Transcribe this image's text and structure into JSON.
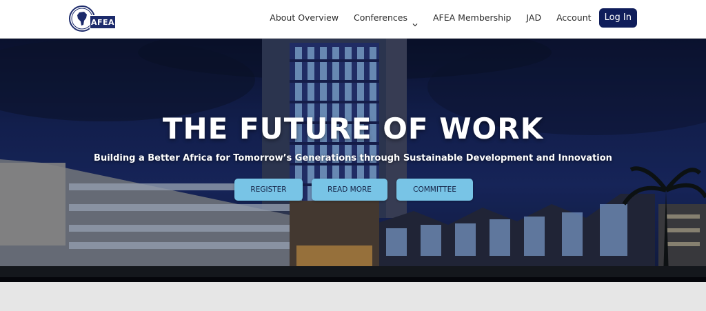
{
  "header": {
    "logo_text": "AFEA",
    "nav": [
      {
        "label": "About Overview",
        "icon": null
      },
      {
        "label": "Conferences",
        "icon": "chevron-down-icon"
      },
      {
        "label": "AFEA Membership",
        "icon": null
      },
      {
        "label": "JAD",
        "icon": null
      },
      {
        "label": "Account",
        "icon": null
      }
    ],
    "login_label": "Log In"
  },
  "hero": {
    "title": "THE FUTURE OF WORK",
    "subtitle": "Building a Better Africa for Tomorrow’s Generations through Sustainable Development and Innovation",
    "buttons": [
      {
        "label": "REGISTER"
      },
      {
        "label": "READ MORE"
      },
      {
        "label": "COMMITTEE"
      }
    ]
  },
  "colors": {
    "brand_navy": "#0f1d5a",
    "cta_blue": "#78c4e6",
    "sky": "#1c2e6f"
  }
}
